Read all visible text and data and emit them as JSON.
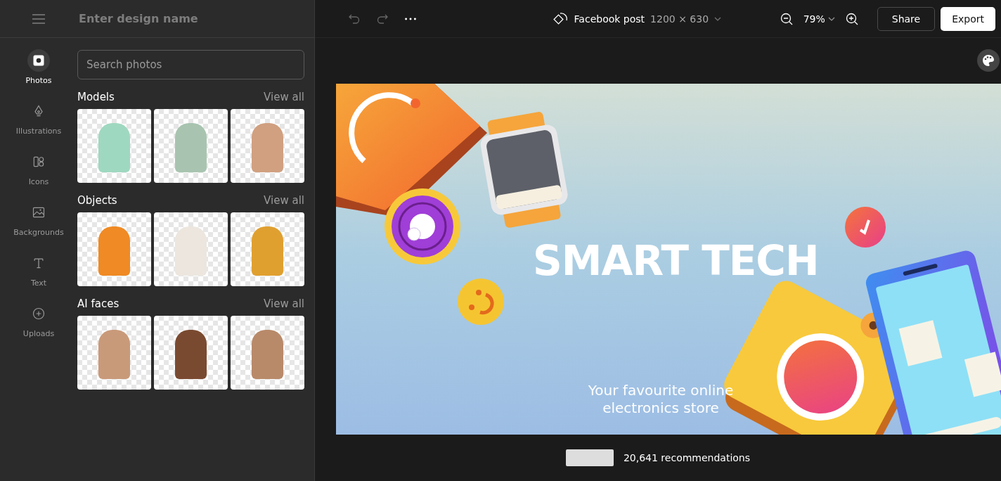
{
  "header": {
    "design_name_placeholder": "Enter design name"
  },
  "rail": [
    {
      "label": "Photos",
      "selected": true
    },
    {
      "label": "Illustrations",
      "selected": false
    },
    {
      "label": "Icons",
      "selected": false
    },
    {
      "label": "Backgrounds",
      "selected": false
    },
    {
      "label": "Text",
      "selected": false
    },
    {
      "label": "Uploads",
      "selected": false
    }
  ],
  "search": {
    "placeholder": "Search photos"
  },
  "sections": [
    {
      "title": "Models",
      "link": "View all"
    },
    {
      "title": "Objects",
      "link": "View all"
    },
    {
      "title": "AI faces",
      "link": "View all"
    }
  ],
  "toolbar": {
    "undo_disabled": true,
    "redo_disabled": true,
    "format": "Facebook post",
    "size": "1200 × 630",
    "zoom": "79%",
    "share": "Share",
    "export": "Export"
  },
  "canvas": {
    "headline": "SMART TECH",
    "tagline": "Your favourite online electronics store"
  },
  "footer": {
    "recommendations": "20,641 recommendations"
  }
}
